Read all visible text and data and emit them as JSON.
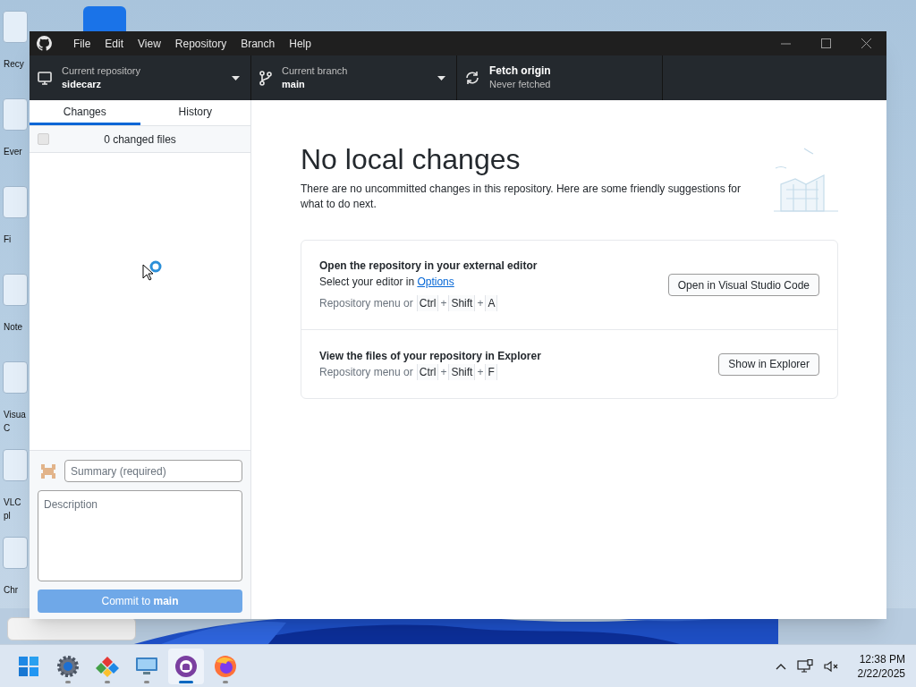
{
  "desktop": {
    "icons": [
      {
        "lines": [
          "Recy"
        ]
      },
      {
        "lines": [
          "Ever"
        ]
      },
      {
        "lines": [
          "Fi"
        ]
      },
      {
        "lines": [
          "Note"
        ]
      },
      {
        "lines": [
          "Visua",
          "C"
        ]
      },
      {
        "lines": [
          "VLC",
          "pl"
        ]
      },
      {
        "lines": [
          "Chr"
        ]
      }
    ]
  },
  "window": {
    "menu": [
      "File",
      "Edit",
      "View",
      "Repository",
      "Branch",
      "Help"
    ],
    "toolbar": [
      {
        "kind": "repository",
        "label": "Current repository",
        "value": "sidecarz"
      },
      {
        "kind": "branch",
        "label": "Current branch",
        "value": "main"
      },
      {
        "kind": "fetch",
        "label": "Fetch origin",
        "value": "Never fetched"
      }
    ],
    "tabs": [
      {
        "label": "Changes",
        "selected": true
      },
      {
        "label": "History",
        "selected": false
      }
    ],
    "changes": {
      "label": "0 changed files",
      "checked": false,
      "disabled": true
    },
    "commit": {
      "summary_placeholder": "Summary (required)",
      "description_placeholder": "Description",
      "button": "Commit to **main**",
      "disabled": true
    },
    "main": {
      "title": "No local changes",
      "text": "There are no uncommitted changes in this repository. Here are some friendly suggestions for what to do next.",
      "suggestions": [
        {
          "title": "Open the repository in your external editor",
          "hint": "Select your editor in ",
          "link": "Options",
          "prefix": "Repository menu or",
          "shortcut": [
            {
              "kind": "key",
              "text": "Ctrl"
            },
            {
              "kind": "plus",
              "text": "+"
            },
            {
              "kind": "key",
              "text": "Shift"
            },
            {
              "kind": "plus",
              "text": "+"
            },
            {
              "kind": "key",
              "text": "A"
            }
          ],
          "button": "Open in Visual Studio Code"
        },
        {
          "title": "View the files of your repository in Explorer",
          "prefix": "Repository menu or",
          "shortcut": [
            {
              "kind": "key",
              "text": "Ctrl"
            },
            {
              "kind": "plus",
              "text": "+"
            },
            {
              "kind": "key",
              "text": "Shift"
            },
            {
              "kind": "plus",
              "text": "+"
            },
            {
              "kind": "key",
              "text": "F"
            }
          ],
          "button": "Show in Explorer"
        }
      ]
    }
  },
  "taskbar": {
    "apps": [
      {
        "kind": "start",
        "selected": false
      },
      {
        "kind": "settings",
        "selected": false
      },
      {
        "kind": "shapes",
        "selected": false
      },
      {
        "kind": "monitor",
        "selected": false
      },
      {
        "kind": "github",
        "selected": true
      },
      {
        "kind": "browser",
        "selected": false
      }
    ],
    "time": "12:38 PM",
    "date": "2/22/2025"
  }
}
